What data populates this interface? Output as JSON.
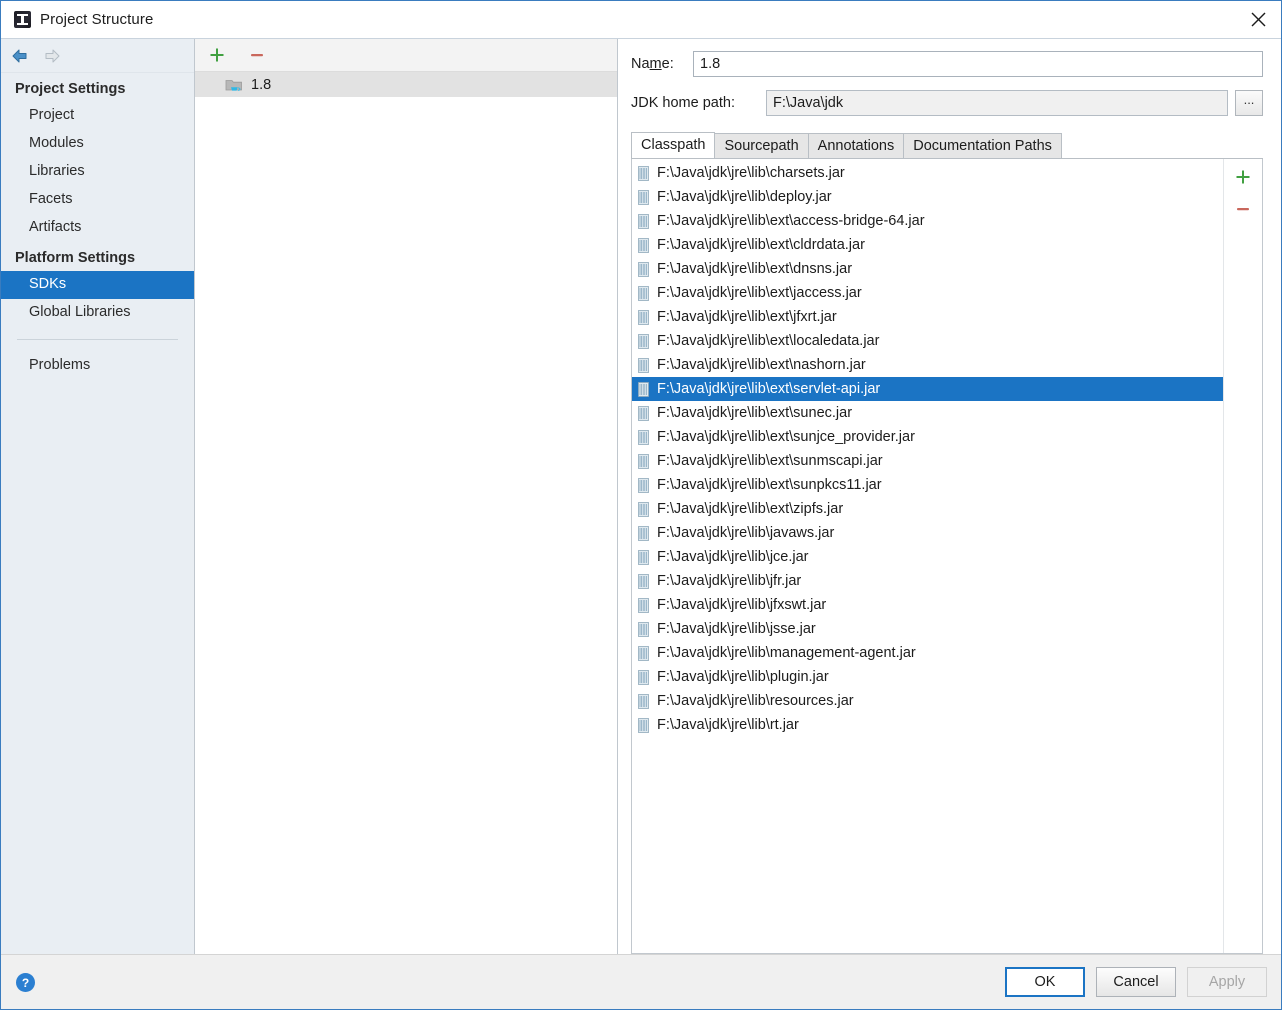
{
  "window": {
    "title": "Project Structure",
    "app_icon": "intellij-idea-icon",
    "close_label": "×"
  },
  "sidebar": {
    "nav": {
      "back": "back-arrow",
      "forward": "forward-arrow"
    },
    "groups": [
      {
        "label": "Project Settings",
        "items": [
          {
            "label": "Project",
            "selected": false
          },
          {
            "label": "Modules",
            "selected": false
          },
          {
            "label": "Libraries",
            "selected": false
          },
          {
            "label": "Facets",
            "selected": false
          },
          {
            "label": "Artifacts",
            "selected": false
          }
        ]
      },
      {
        "label": "Platform Settings",
        "items": [
          {
            "label": "SDKs",
            "selected": true
          },
          {
            "label": "Global Libraries",
            "selected": false
          }
        ]
      }
    ],
    "extra_items": [
      {
        "label": "Problems",
        "selected": false
      }
    ]
  },
  "sdk_list": {
    "toolbar": {
      "add_label": "+",
      "remove_label": "−"
    },
    "items": [
      {
        "label": "1.8",
        "selected": true
      }
    ]
  },
  "details": {
    "name_label": "Name:",
    "name_label_pre": "Na",
    "name_label_mnemonic": "m",
    "name_label_post": "e:",
    "name_value": "1.8",
    "jdk_home_label": "JDK home path:",
    "jdk_home_value": "F:\\Java\\jdk",
    "browse_label": "...",
    "tabs": [
      {
        "label": "Classpath",
        "active": true
      },
      {
        "label": "Sourcepath",
        "active": false
      },
      {
        "label": "Annotations",
        "active": false
      },
      {
        "label": "Documentation Paths",
        "active": false
      }
    ],
    "classpath_toolbar": {
      "add_label": "+",
      "remove_label": "−"
    },
    "classpath_entries": [
      {
        "path": "F:\\Java\\jdk\\jre\\lib\\charsets.jar",
        "selected": false
      },
      {
        "path": "F:\\Java\\jdk\\jre\\lib\\deploy.jar",
        "selected": false
      },
      {
        "path": "F:\\Java\\jdk\\jre\\lib\\ext\\access-bridge-64.jar",
        "selected": false
      },
      {
        "path": "F:\\Java\\jdk\\jre\\lib\\ext\\cldrdata.jar",
        "selected": false
      },
      {
        "path": "F:\\Java\\jdk\\jre\\lib\\ext\\dnsns.jar",
        "selected": false
      },
      {
        "path": "F:\\Java\\jdk\\jre\\lib\\ext\\jaccess.jar",
        "selected": false
      },
      {
        "path": "F:\\Java\\jdk\\jre\\lib\\ext\\jfxrt.jar",
        "selected": false
      },
      {
        "path": "F:\\Java\\jdk\\jre\\lib\\ext\\localedata.jar",
        "selected": false
      },
      {
        "path": "F:\\Java\\jdk\\jre\\lib\\ext\\nashorn.jar",
        "selected": false
      },
      {
        "path": "F:\\Java\\jdk\\jre\\lib\\ext\\servlet-api.jar",
        "selected": true
      },
      {
        "path": "F:\\Java\\jdk\\jre\\lib\\ext\\sunec.jar",
        "selected": false
      },
      {
        "path": "F:\\Java\\jdk\\jre\\lib\\ext\\sunjce_provider.jar",
        "selected": false
      },
      {
        "path": "F:\\Java\\jdk\\jre\\lib\\ext\\sunmscapi.jar",
        "selected": false
      },
      {
        "path": "F:\\Java\\jdk\\jre\\lib\\ext\\sunpkcs11.jar",
        "selected": false
      },
      {
        "path": "F:\\Java\\jdk\\jre\\lib\\ext\\zipfs.jar",
        "selected": false
      },
      {
        "path": "F:\\Java\\jdk\\jre\\lib\\javaws.jar",
        "selected": false
      },
      {
        "path": "F:\\Java\\jdk\\jre\\lib\\jce.jar",
        "selected": false
      },
      {
        "path": "F:\\Java\\jdk\\jre\\lib\\jfr.jar",
        "selected": false
      },
      {
        "path": "F:\\Java\\jdk\\jre\\lib\\jfxswt.jar",
        "selected": false
      },
      {
        "path": "F:\\Java\\jdk\\jre\\lib\\jsse.jar",
        "selected": false
      },
      {
        "path": "F:\\Java\\jdk\\jre\\lib\\management-agent.jar",
        "selected": false
      },
      {
        "path": "F:\\Java\\jdk\\jre\\lib\\plugin.jar",
        "selected": false
      },
      {
        "path": "F:\\Java\\jdk\\jre\\lib\\resources.jar",
        "selected": false
      },
      {
        "path": "F:\\Java\\jdk\\jre\\lib\\rt.jar",
        "selected": false
      }
    ]
  },
  "footer": {
    "help_label": "?",
    "buttons": [
      {
        "label": "OK",
        "style": "default",
        "enabled": true
      },
      {
        "label": "Cancel",
        "style": "normal",
        "enabled": true
      },
      {
        "label": "Apply",
        "style": "disabled",
        "enabled": false
      }
    ]
  },
  "colors": {
    "selection_blue": "#1b74c4",
    "sidebar_bg": "#e9eef3",
    "dialog_border": "#3a7cbf",
    "add_icon_green": "#41a041",
    "remove_icon_red": "#c9675c"
  }
}
